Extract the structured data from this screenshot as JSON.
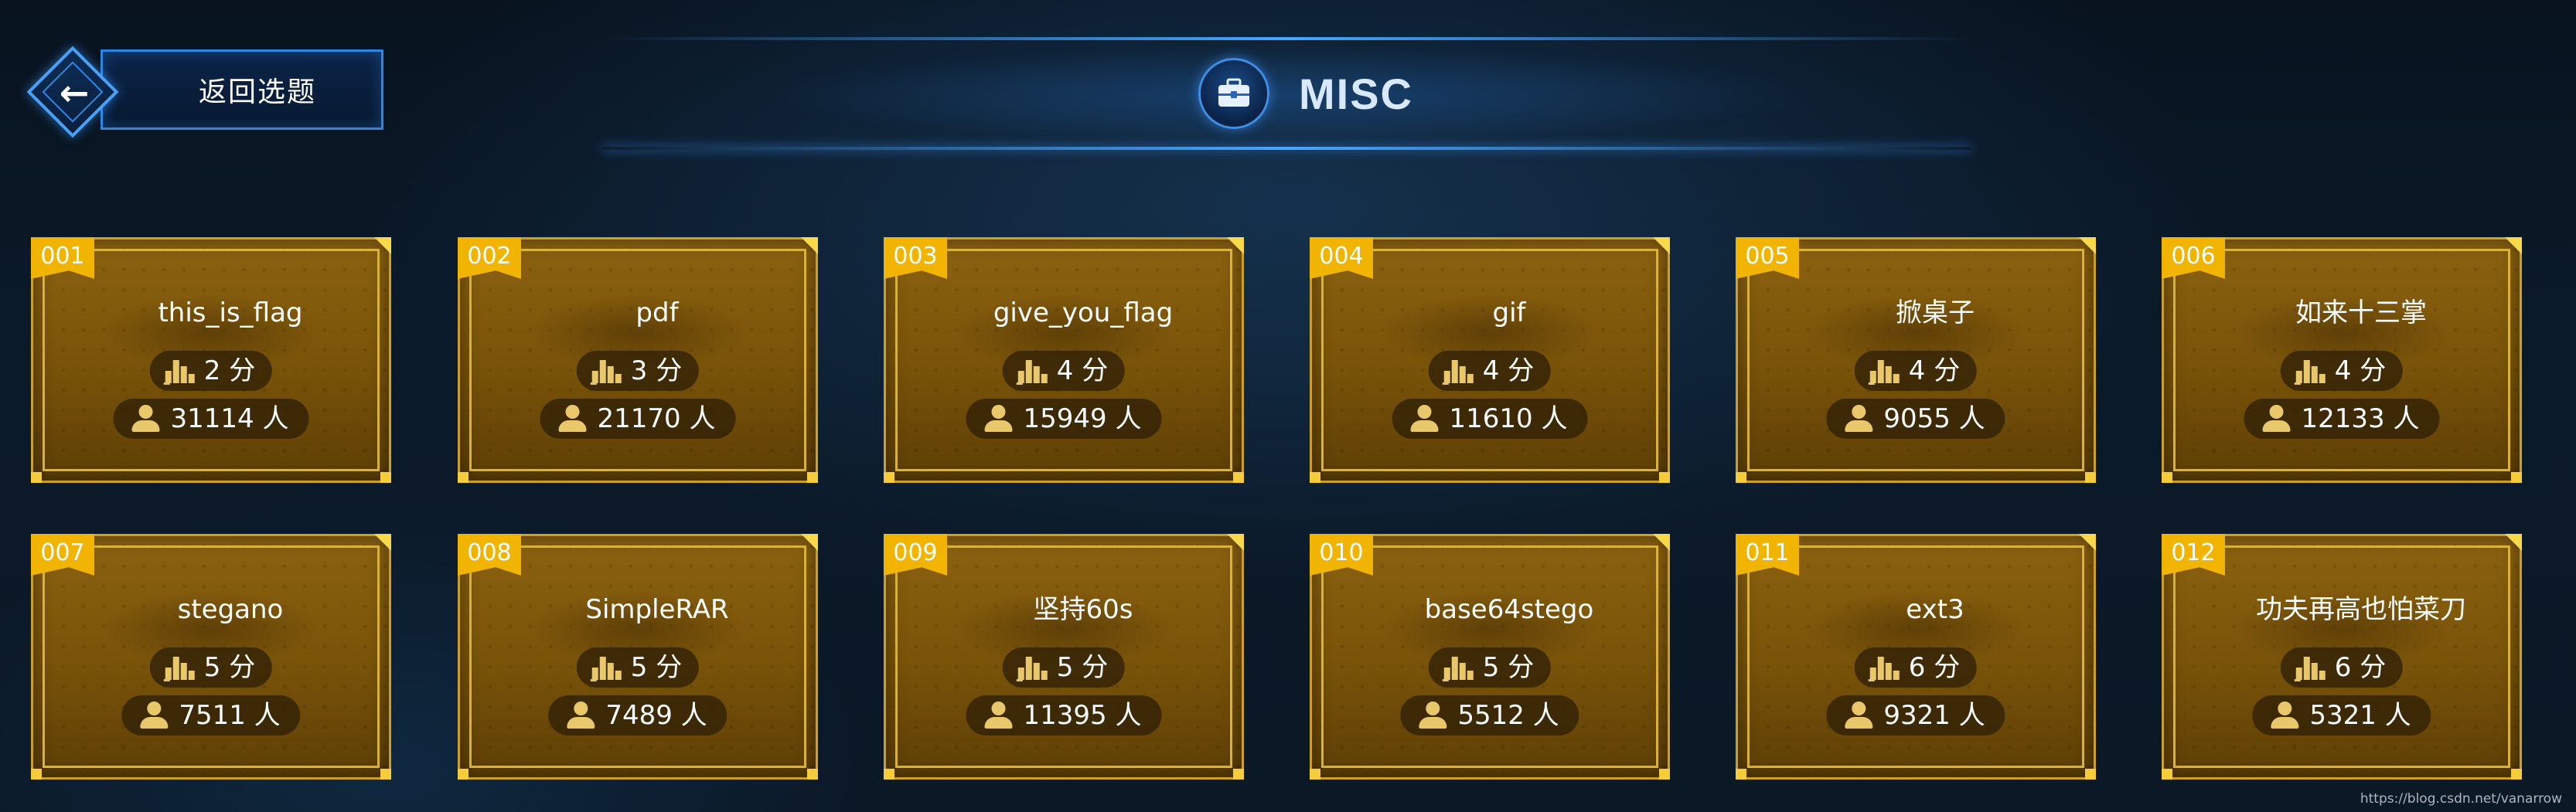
{
  "header": {
    "back_label": "返回选题",
    "title": "MISC",
    "title_icon": "briefcase-icon"
  },
  "cards": [
    {
      "id": "001",
      "name": "this_is_flag",
      "score": "2 分",
      "solved": "31114 人"
    },
    {
      "id": "002",
      "name": "pdf",
      "score": "3 分",
      "solved": "21170 人"
    },
    {
      "id": "003",
      "name": "give_you_flag",
      "score": "4 分",
      "solved": "15949 人"
    },
    {
      "id": "004",
      "name": "gif",
      "score": "4 分",
      "solved": "11610 人"
    },
    {
      "id": "005",
      "name": "掀桌子",
      "score": "4 分",
      "solved": "9055 人"
    },
    {
      "id": "006",
      "name": "如来十三掌",
      "score": "4 分",
      "solved": "12133 人"
    },
    {
      "id": "007",
      "name": "stegano",
      "score": "5 分",
      "solved": "7511 人"
    },
    {
      "id": "008",
      "name": "SimpleRAR",
      "score": "5 分",
      "solved": "7489 人"
    },
    {
      "id": "009",
      "name": "坚持60s",
      "score": "5 分",
      "solved": "11395 人"
    },
    {
      "id": "010",
      "name": "base64stego",
      "score": "5 分",
      "solved": "5512 人"
    },
    {
      "id": "011",
      "name": "ext3",
      "score": "6 分",
      "solved": "9321 人"
    },
    {
      "id": "012",
      "name": "功夫再高也怕菜刀",
      "score": "6 分",
      "solved": "5321 人"
    }
  ],
  "icons": {
    "back": "arrow-left-icon",
    "score": "bar-chart-icon",
    "solved": "user-icon"
  },
  "colors": {
    "background": "#0b1a29",
    "accent_blue": "#2f86e0",
    "card_gold": "#caa02b",
    "id_badge": "#f1b400"
  },
  "watermark": "https://blog.csdn.net/vanarrow"
}
